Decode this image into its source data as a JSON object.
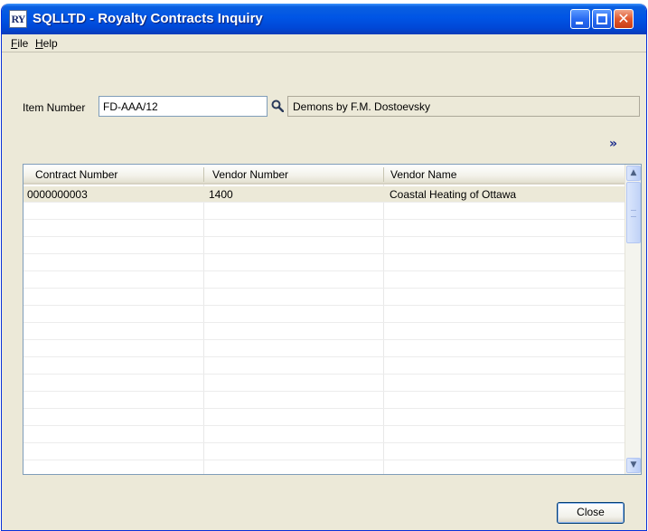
{
  "window": {
    "app_icon_text": "RY",
    "title": "SQLLTD - Royalty Contracts Inquiry",
    "accent_color": "#0055e5"
  },
  "menu": {
    "file": "File",
    "help": "Help"
  },
  "item": {
    "label": "Item Number",
    "value": "FD-AAA/12",
    "description": "Demons by F.M. Dostoevsky"
  },
  "icons": {
    "lookup": "magnifier-icon",
    "more": "double-chevron-right-icon",
    "more_glyph": "»"
  },
  "grid": {
    "columns": [
      "Contract Number",
      "Vendor Number",
      "Vendor Name"
    ],
    "rows": [
      [
        "0000000003",
        "1400",
        "Coastal Heating of Ottawa"
      ]
    ]
  },
  "buttons": {
    "close": "Close"
  }
}
